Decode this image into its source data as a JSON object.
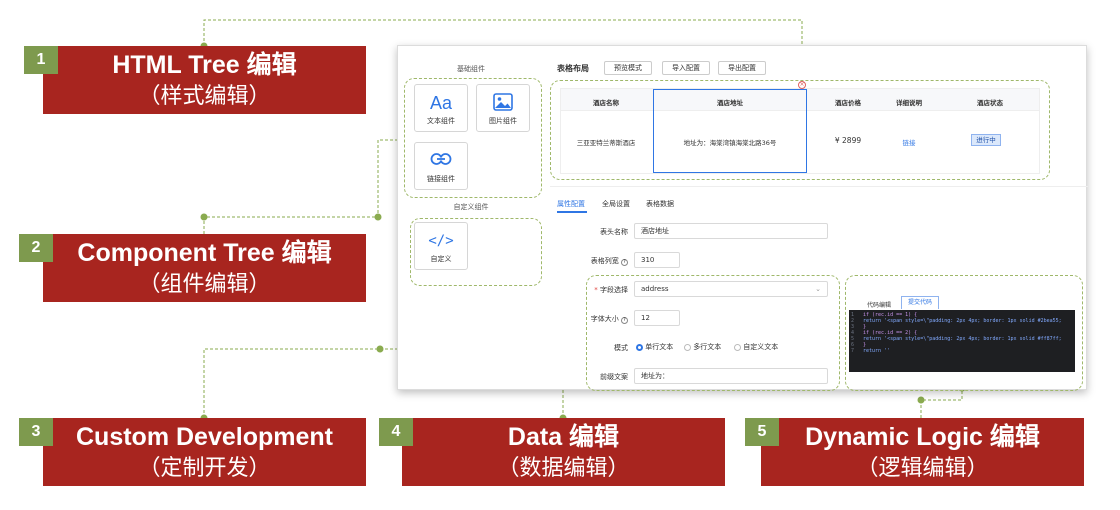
{
  "callouts": [
    {
      "num": "1",
      "title": "HTML Tree 编辑",
      "subtitle": "（样式编辑）"
    },
    {
      "num": "2",
      "title": "Component Tree 编辑",
      "subtitle": "（组件编辑）"
    },
    {
      "num": "3",
      "title": "Custom Development",
      "subtitle": "（定制开发）"
    },
    {
      "num": "4",
      "title": "Data 编辑",
      "subtitle": "（数据编辑）"
    },
    {
      "num": "5",
      "title": "Dynamic Logic 编辑",
      "subtitle": "（逻辑编辑）"
    }
  ],
  "sidebar": {
    "basic_title": "基础组件",
    "text_component": "文本组件",
    "image_component": "图片组件",
    "link_component": "链接组件",
    "custom_title": "自定义组件",
    "custom_component": "自定义"
  },
  "toolbar": {
    "title": "表格布局",
    "preview": "预览模式",
    "import": "导入配置",
    "export": "导出配置"
  },
  "table": {
    "headers": [
      "酒店名称",
      "酒店地址",
      "酒店价格",
      "详细说明",
      "酒店状态"
    ],
    "row": {
      "name": "三亚亚特兰蒂斯酒店",
      "address": "地址为：海棠湾镇海棠北路36号",
      "price": "¥ 2899",
      "link": "链接",
      "status": "进行中"
    }
  },
  "tabs": [
    "属性配置",
    "全局设置",
    "表格数据"
  ],
  "form": {
    "header_name_label": "表头名称",
    "header_name_value": "酒店地址",
    "column_width_label": "表格列宽",
    "column_width_value": "310",
    "field_select_label": "字段选择",
    "field_select_value": "address",
    "font_size_label": "字体大小",
    "font_size_value": "12",
    "mode_label": "模式",
    "mode_options": [
      "单行文本",
      "多行文本",
      "自定义文本"
    ],
    "prefix_label": "前缀文案",
    "prefix_value": "地址为："
  },
  "code_editor": {
    "tab_code": "代码编辑",
    "tab_submit": "提交代码",
    "line_numbers": [
      "1",
      "2",
      "3",
      "4",
      "5",
      "6",
      "7"
    ],
    "lines": [
      "if (rec.id == 1) {",
      "  return '<span style=\\\"padding: 2px 4px; border: 1px solid #2bea55;",
      "}",
      "if (rec.id == 2) {",
      "  return '<span style=\\\"padding: 2px 4px; border: 1px solid #ff87ff;",
      "}",
      "return ''"
    ]
  },
  "colors": {
    "callout_bg": "#a8251f",
    "badge_bg": "#7e9a4e",
    "connector": "#8aab4f",
    "accent": "#2f76e4"
  }
}
